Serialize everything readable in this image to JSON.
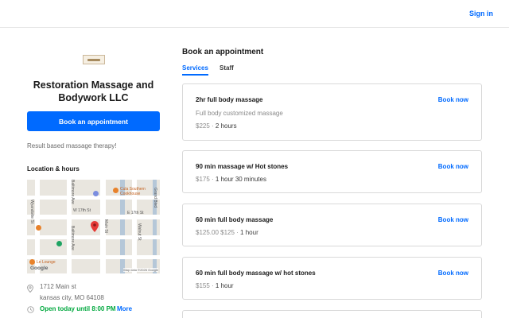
{
  "header": {
    "signin_label": "Sign in"
  },
  "business": {
    "name": "Restoration Massage and Bodywork LLC",
    "book_label": "Book an appointment",
    "tagline": "Result based massage therapy!",
    "location_heading": "Location & hours",
    "address_line1": "1712 Main st",
    "address_line2": "kansas city, MO 64108",
    "hours_status": "Open today until 8:00 PM",
    "more_label": "More"
  },
  "map": {
    "labels": {
      "w17": "W 17th St",
      "e17": "E 17th St",
      "main": "Main St",
      "baltimore1": "Baltimore Ave",
      "baltimore2": "Baltimore Ave",
      "wyandotte": "Wyandotte St",
      "walnut": "Walnut St",
      "grand": "Grand Blvd",
      "cafe": "Cula Southern",
      "cafe2": "Cookhouse",
      "lounge": "Le Lounge",
      "google": "Google",
      "mapdata": "Map data ©2026 Google"
    }
  },
  "appointments": {
    "heading": "Book an appointment",
    "tabs": [
      "Services",
      "Staff"
    ],
    "book_now_label": "Book now",
    "services": [
      {
        "name": "2hr full body massage",
        "description": "Full body customized massage",
        "price": "$225",
        "duration": "2 hours"
      },
      {
        "name": "90 min massage w/ Hot stones",
        "price": "$175",
        "duration": "1 hour 30 minutes"
      },
      {
        "name": "60 min full body massage",
        "price": "$125.00 $125",
        "duration": "1 hour"
      },
      {
        "name": "60 min full body massage w/ hot stones",
        "price": "$155",
        "duration": "1 hour"
      }
    ]
  },
  "colors": {
    "accent": "#006aff",
    "open": "#00a83e"
  }
}
